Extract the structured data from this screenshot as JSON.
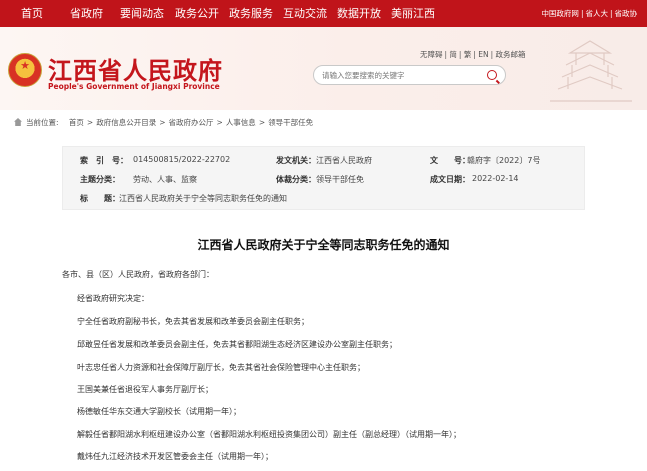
{
  "nav": {
    "items": [
      "首页",
      "省政府",
      "要闻动态",
      "政务公开",
      "政务服务",
      "互动交流",
      "数据开放",
      "美丽江西"
    ],
    "right_links": [
      "中国政府网",
      "省人大",
      "省政协"
    ]
  },
  "header": {
    "title": "江西省人民政府",
    "subtitle": "People's Government of Jiangxi Province",
    "utility_links": [
      "无障碍",
      "简",
      "繁",
      "EN",
      "政务邮箱"
    ],
    "search_placeholder": "请输入您要搜索的关键字"
  },
  "breadcrumb": {
    "label": "当前位置:",
    "items": [
      "首页",
      "政府信息公开目录",
      "省政府办公厅",
      "人事信息",
      "领导干部任免"
    ]
  },
  "meta": {
    "index_key": "索　引　号：",
    "index_val": "014500815/2022-22702",
    "issuer_key": "发文机关：",
    "issuer_val": "江西省人民政府",
    "docno_key": "文　　号：",
    "docno_val": "赣府字〔2022〕7号",
    "topic_key": "主题分类：",
    "topic_val": "劳动、人事、监察",
    "genre_key": "体裁分类：",
    "genre_val": "领导干部任免",
    "date_key": "成文日期：",
    "date_val": "2022-02-14",
    "subject_key": "标　　题：",
    "subject_val": "江西省人民政府关于宁全等同志职务任免的通知"
  },
  "article": {
    "title": "江西省人民政府关于宁全等同志职务任免的通知",
    "salutation": "各市、县（区）人民政府，省政府各部门：",
    "paragraphs": [
      "经省政府研究决定：",
      "宁全任省政府副秘书长，免去其省发展和改革委员会副主任职务；",
      "邱敢昱任省发展和改革委员会副主任，免去其省鄱阳湖生态经济区建设办公室副主任职务；",
      "叶志忠任省人力资源和社会保障厅副厅长，免去其省社会保险管理中心主任职务；",
      "王国美兼任省退役军人事务厅副厅长；",
      "杨德敏任华东交通大学副校长（试用期一年）；",
      "解毅任省鄱阳湖水利枢纽建设办公室（省鄱阳湖水利枢纽投资集团公司）副主任（副总经理）（试用期一年）；",
      "戴炜任九江经济技术开发区管委会主任（试用期一年）；"
    ]
  },
  "colors": {
    "brand_red": "#c0141a"
  }
}
